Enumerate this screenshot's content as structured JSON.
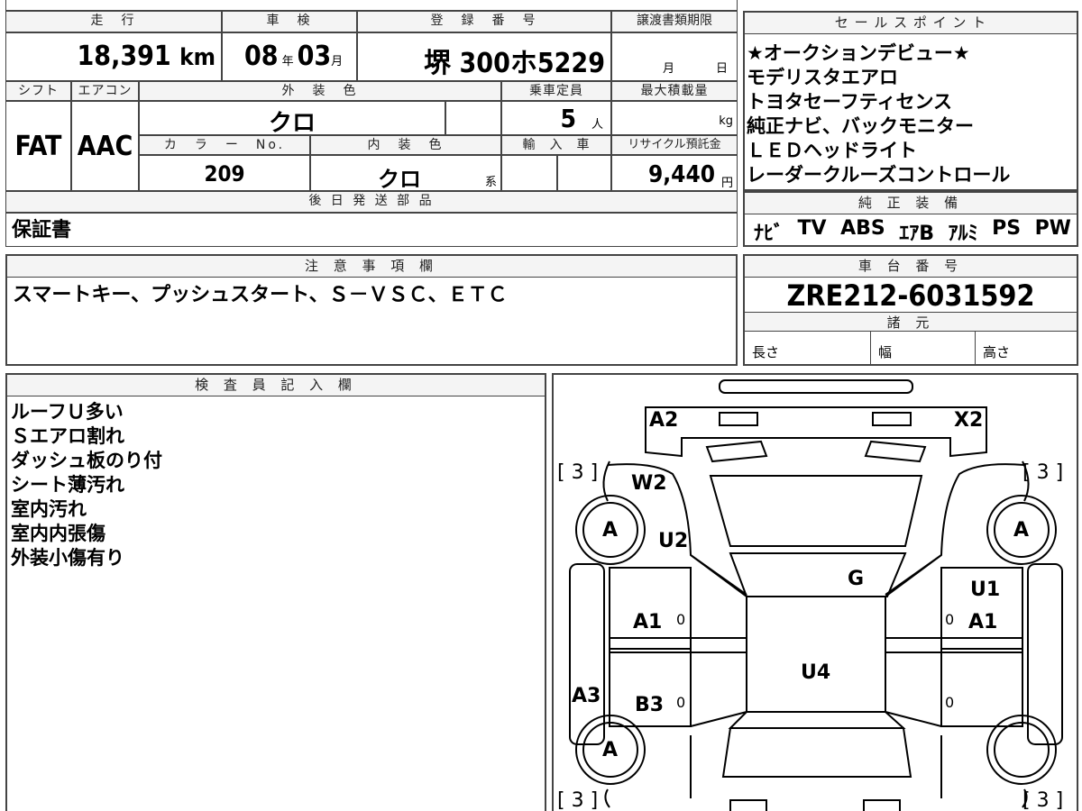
{
  "top": {
    "labels": {
      "mileage": "走　行",
      "inspection": "車　検",
      "registration": "登　録　番　号",
      "transfer_deadline": "譲渡書類期限",
      "shift": "シフト",
      "aircon": "エアコン",
      "exterior_color": "外　装　色",
      "capacity": "乗車定員",
      "max_load": "最大積載量",
      "color_no": "カ　ラ　ー　No.",
      "interior_color": "内　装　色",
      "import": "輸　入　車",
      "recycle_fee": "リサイクル預託金"
    },
    "mileage_value": "18,391",
    "mileage_unit": "km",
    "inspection_year": "08",
    "inspection_year_unit": "年",
    "inspection_month": "03",
    "inspection_month_unit": "月",
    "registration_number": "堺 300ホ5229",
    "deadline_month_unit": "月",
    "deadline_day_unit": "日",
    "shift_value": "FAT",
    "aircon_value": "AAC",
    "exterior_color_value": "クロ",
    "capacity_value": "5",
    "capacity_unit": "人",
    "max_load_unit": "kg",
    "color_no_value": "209",
    "interior_color_value": "クロ",
    "interior_color_suffix": "系",
    "recycle_fee_value": "9,440",
    "recycle_fee_unit": "円"
  },
  "sales_points": {
    "header": "セ ー ル ス ポ イ ン ト",
    "lines": [
      "★オークションデビュー★",
      "モデリスタエアロ",
      "トヨタセーフティセンス",
      "純正ナビ、バックモニター",
      "ＬＥＤヘッドライト",
      "レーダークルーズコントロール"
    ]
  },
  "later_parts": {
    "header": "後 日 発 送 部 品",
    "value": "保証書"
  },
  "genuine_equipment": {
    "header": "純 正 装 備",
    "items": [
      "ﾅﾋﾞ",
      "TV",
      "ABS",
      "ｴｱB",
      "ｱﾙﾐ",
      "PS",
      "PW"
    ]
  },
  "notes": {
    "header": "注 意 事 項 欄",
    "value": "スマートキー、プッシュスタート、Ｓ－ＶＳＣ、ＥＴＣ"
  },
  "chassis": {
    "header": "車 台 番 号",
    "value": "ZRE212-6031592",
    "spec_header": "諸 元",
    "length_label": "長さ",
    "width_label": "幅",
    "height_label": "高さ"
  },
  "inspector": {
    "header": "検 査 員 記 入 欄",
    "lines": [
      "ルーフＵ多い",
      "Ｓエアロ割れ",
      "ダッシュ板のり付",
      "シート薄汚れ",
      "室内汚れ",
      "室内内張傷",
      "外装小傷有り"
    ]
  },
  "diagram": {
    "labels": {
      "a2": "A2",
      "x2": "X2",
      "w2": "W2",
      "u2": "U2",
      "g": "G",
      "u1": "U1",
      "a1_left": "A1",
      "a1_right": "A1",
      "u4": "U4",
      "a3": "A3",
      "b3": "B3",
      "tire_fl": "A",
      "tire_fr": "A",
      "tire_rl": "A",
      "zero_1": "0",
      "zero_2": "0",
      "zero_3": "0",
      "zero_4": "0",
      "bracket_tl": "[ 3 ]",
      "bracket_tr": "[ 3 ]",
      "bracket_bl": "[ 3 ]",
      "bracket_br": "[ 3 ]"
    }
  }
}
